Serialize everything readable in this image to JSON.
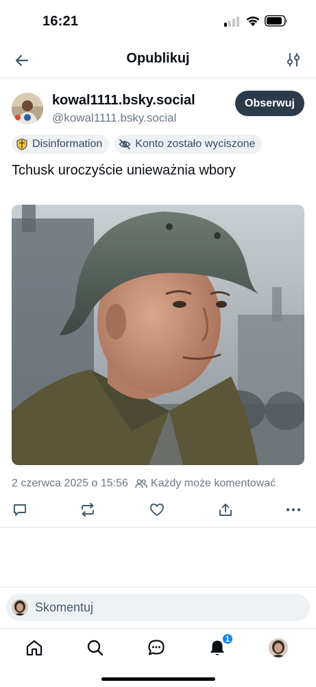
{
  "status_bar": {
    "time": "16:21",
    "signal_icon": "cellular-signal-icon",
    "wifi_icon": "wifi-icon",
    "battery_icon": "battery-icon"
  },
  "header": {
    "title": "Opublikuj",
    "back_icon": "arrow-left-icon",
    "settings_icon": "sliders-icon"
  },
  "post": {
    "author": {
      "display_name": "kowal1111.bsky.social",
      "handle": "@kowal1111.bsky.social"
    },
    "follow_label": "Obserwuj",
    "labels": [
      {
        "text": "Disinformation",
        "icon": "labeler-shield-icon"
      },
      {
        "text": "Konto zostało wyciszone",
        "icon": "eye-slash-icon"
      }
    ],
    "text": "Tchusk uroczyście unieważnia wbory",
    "timestamp": "2 czerwca 2025 o 15:56",
    "reply_permission": "Każdy może komentować",
    "actions": {
      "reply_icon": "comment-icon",
      "repost_icon": "repost-icon",
      "like_icon": "heart-icon",
      "share_icon": "share-icon",
      "more_icon": "more-dots-icon"
    }
  },
  "composer": {
    "placeholder": "Skomentuj"
  },
  "bottom_nav": {
    "items": [
      "home-icon",
      "search-icon",
      "chat-icon",
      "bell-icon",
      "profile-avatar"
    ],
    "notifications_badge": "1"
  },
  "colors": {
    "accent": "#1083fe",
    "follow_bg": "#2c3a4b",
    "muted_text": "#6b7785",
    "pill_bg": "#eef2f5"
  }
}
